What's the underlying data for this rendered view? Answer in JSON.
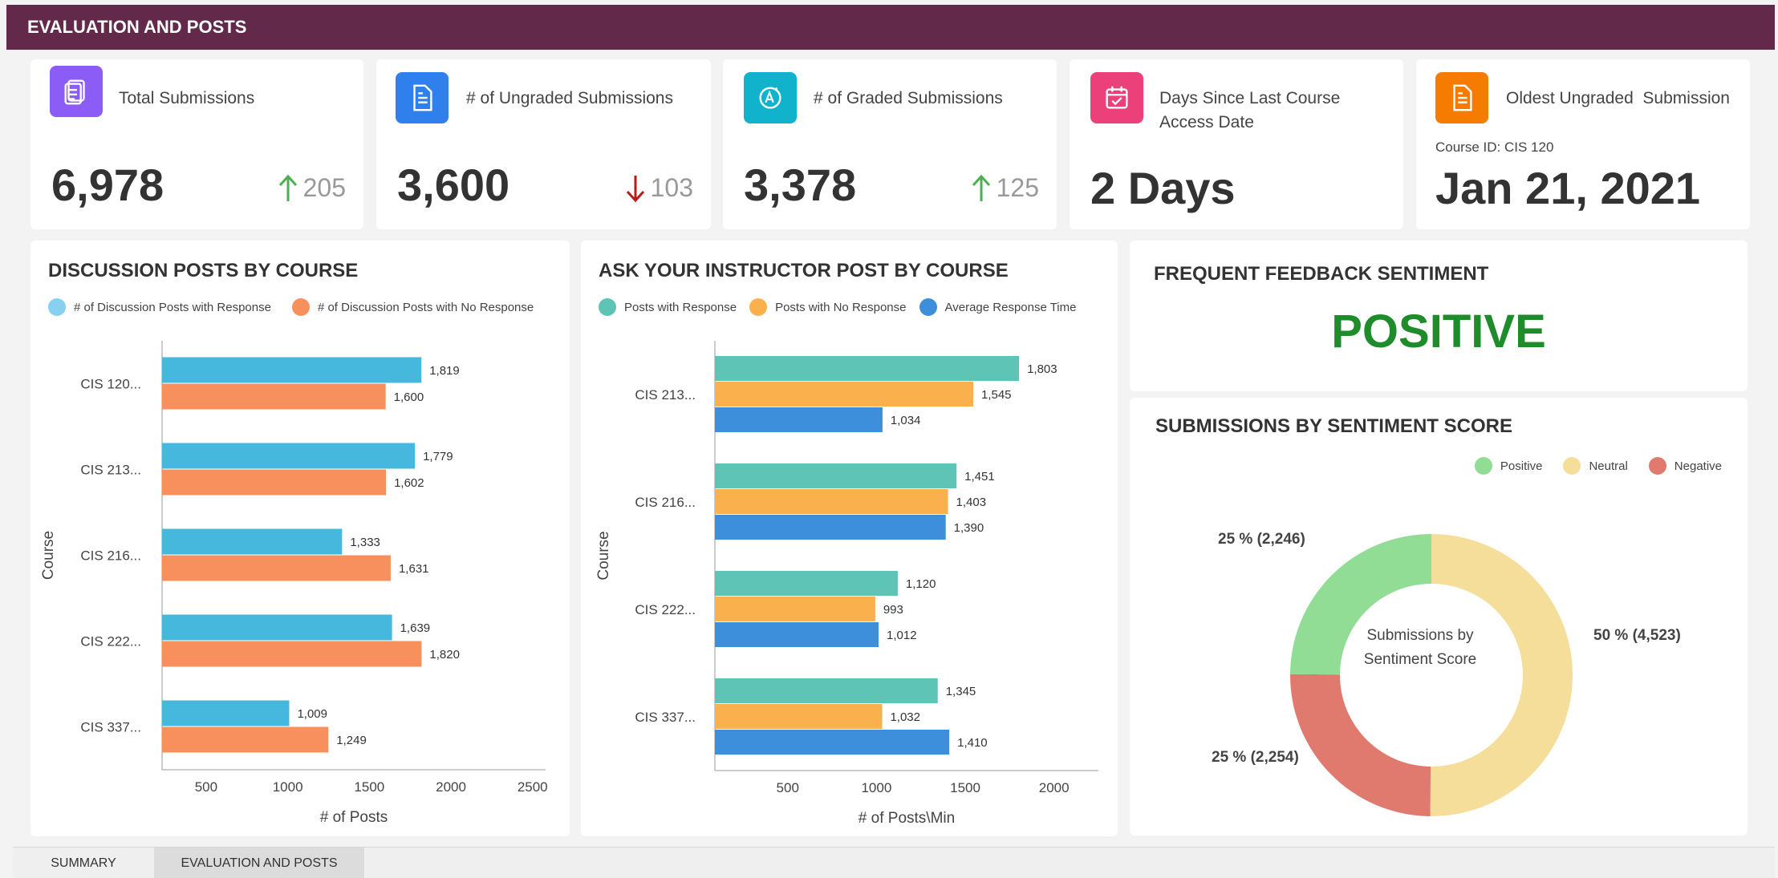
{
  "header": {
    "title": "EVALUATION AND POSTS"
  },
  "kpis": [
    {
      "label": "Total Submissions",
      "value": "6,978",
      "delta": "205",
      "direction": "up",
      "icon": "document-stack-icon",
      "color": "#8b5cf6"
    },
    {
      "label": "# of Ungraded Submissions",
      "value": "3,600",
      "delta": "103",
      "direction": "down",
      "icon": "document-icon",
      "color": "#2f80ed"
    },
    {
      "label": "# of Graded Submissions",
      "value": "3,378",
      "delta": "125",
      "direction": "up",
      "icon": "grade-badge-icon",
      "color": "#11b3cc"
    },
    {
      "label": "Days Since Last Course Access Date",
      "value": "2 Days",
      "icon": "calendar-check-icon",
      "color": "#ec407a"
    },
    {
      "label": "Oldest Ungraded  Submission",
      "sub": "Course ID: CIS 120",
      "value": "Jan 21, 2021",
      "icon": "document-icon",
      "color": "#f57c00"
    }
  ],
  "colors": {
    "up": "#4caf50",
    "down": "#b71c1c"
  },
  "discussion": {
    "title": "DISCUSSION POSTS BY COURSE",
    "legend": [
      "# of Discussion Posts with Response",
      "# of Discussion Posts with No Response"
    ]
  },
  "ask": {
    "title": "ASK YOUR INSTRUCTOR POST BY COURSE",
    "legend": [
      "Posts with Response",
      "Posts with No Response",
      "Average Response Time"
    ]
  },
  "sentiment": {
    "title": "FREQUENT FEEDBACK SENTIMENT",
    "value": "POSITIVE"
  },
  "sentiment_score": {
    "title": "SUBMISSIONS BY SENTIMENT SCORE",
    "legend": [
      "Positive",
      "Neutral",
      "Negative"
    ],
    "center_line1": "Submissions by",
    "center_line2": "Sentiment Score"
  },
  "chart_data": [
    {
      "type": "bar",
      "orientation": "horizontal",
      "title": "DISCUSSION POSTS BY COURSE",
      "xlabel": "# of Posts",
      "ylabel": "Course",
      "categories": [
        "CIS 120...",
        "CIS 213...",
        "CIS 216...",
        "CIS 222...",
        "CIS 337..."
      ],
      "series": [
        {
          "name": "# of Discussion Posts with Response",
          "color": "#47b8dd",
          "values": [
            1819,
            1779,
            1333,
            1639,
            1009
          ]
        },
        {
          "name": "# of Discussion Posts with No Response",
          "color": "#f8905e",
          "values": [
            1600,
            1602,
            1631,
            1820,
            1249
          ]
        }
      ],
      "value_labels": [
        [
          "1,819",
          "1,779",
          "1,333",
          "1,639",
          "1,009"
        ],
        [
          "1,600",
          "1,602",
          "1,631",
          "1,820",
          "1,249"
        ]
      ],
      "xticks": [
        500,
        1000,
        1500,
        2000,
        2500
      ],
      "xtick_labels": [
        "500",
        "1000",
        "1500",
        "2000",
        "2500"
      ],
      "xlim": [
        230,
        2580
      ],
      "legend": "top-left"
    },
    {
      "type": "bar",
      "orientation": "horizontal",
      "title": "ASK YOUR INSTRUCTOR POST BY COURSE",
      "xlabel": "# of Posts\\Min",
      "ylabel": "Course",
      "categories": [
        "CIS 213...",
        "CIS 216...",
        "CIS 222...",
        "CIS 337..."
      ],
      "series": [
        {
          "name": "Posts with Response",
          "color": "#5ec4b6",
          "values": [
            1803,
            1451,
            1120,
            1345
          ]
        },
        {
          "name": "Posts with No Response",
          "color": "#fbb04e",
          "values": [
            1545,
            1403,
            993,
            1032
          ]
        },
        {
          "name": "Average Response Time",
          "color": "#3d8fdb",
          "values": [
            1034,
            1390,
            1012,
            1410
          ]
        }
      ],
      "value_labels": [
        [
          "1,803",
          "1,451",
          "1,120",
          "1,345"
        ],
        [
          "1,545",
          "1,403",
          "993",
          "1,032"
        ],
        [
          "1,034",
          "1,390",
          "1,012",
          "1,410"
        ]
      ],
      "xticks": [
        500,
        1000,
        1500,
        2000
      ],
      "xtick_labels": [
        "500",
        "1000",
        "1500",
        "2000"
      ],
      "xlim": [
        90,
        2250
      ],
      "legend": "top-left"
    },
    {
      "type": "pie",
      "variant": "donut",
      "title": "SUBMISSIONS BY SENTIMENT SCORE",
      "slices": [
        {
          "name": "Neutral",
          "value": 4523,
          "label": "50 % (4,523)",
          "color": "#f5dd9a"
        },
        {
          "name": "Negative",
          "value": 2254,
          "label": "25 % (2,254)",
          "color": "#e07a6e"
        },
        {
          "name": "Positive",
          "value": 2246,
          "label": "25 % (2,246)",
          "color": "#91dd95"
        }
      ],
      "legend": "top-right"
    }
  ],
  "tabs": [
    {
      "label": "SUMMARY",
      "active": false
    },
    {
      "label": "EVALUATION AND POSTS",
      "active": true
    }
  ]
}
